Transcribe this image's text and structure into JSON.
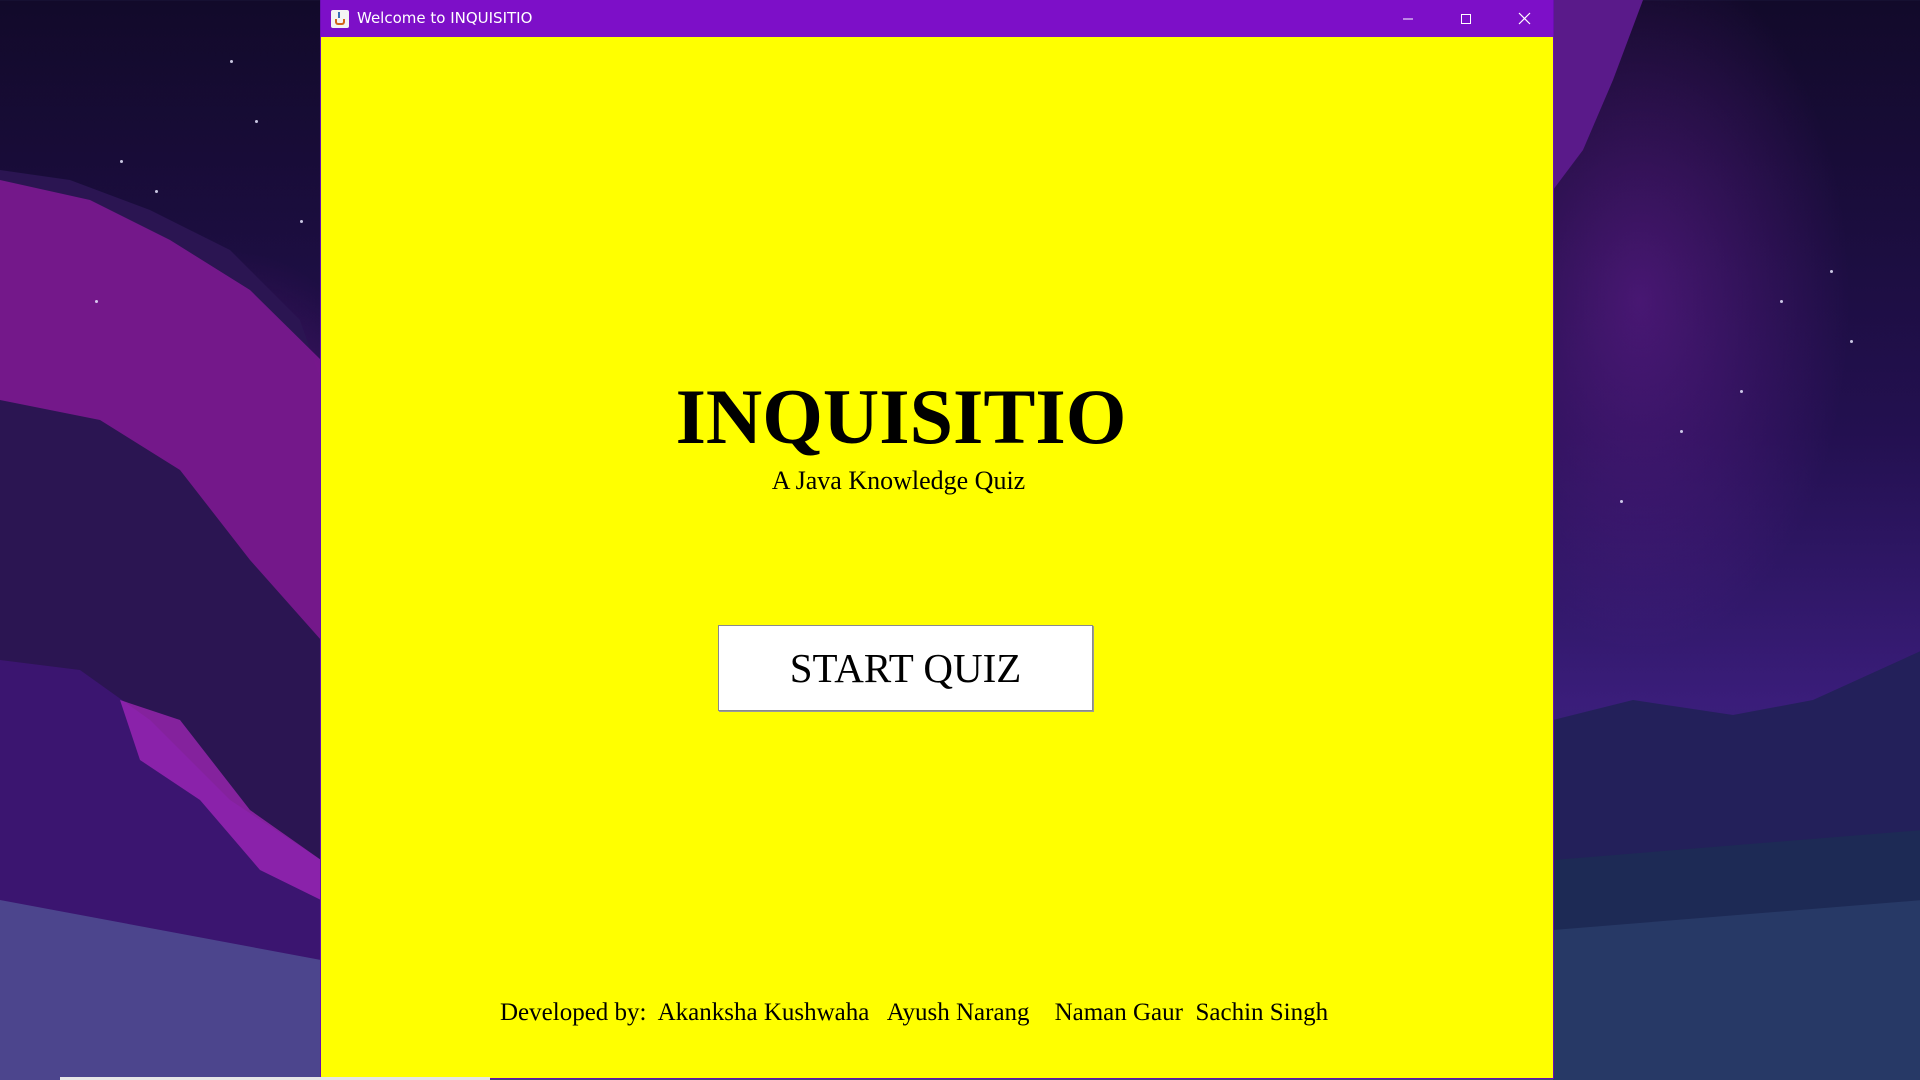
{
  "window": {
    "title": "Welcome to INQUISITIO"
  },
  "main": {
    "title": "INQUISITIO",
    "subtitle": "A Java Knowledge Quiz",
    "start_button_label": "START QUIZ"
  },
  "credits": {
    "prefix": "Developed by:",
    "developers": [
      "Akanksha Kushwaha",
      "Ayush Narang",
      "Naman Gaur",
      "Sachin Singh"
    ]
  },
  "colors": {
    "titlebar": "#7d0fc8",
    "window_background": "#ffff00",
    "button_background": "#ffffff"
  },
  "icons": {
    "app": "java-icon",
    "minimize": "minimize-icon",
    "maximize": "maximize-icon",
    "close": "close-icon"
  }
}
